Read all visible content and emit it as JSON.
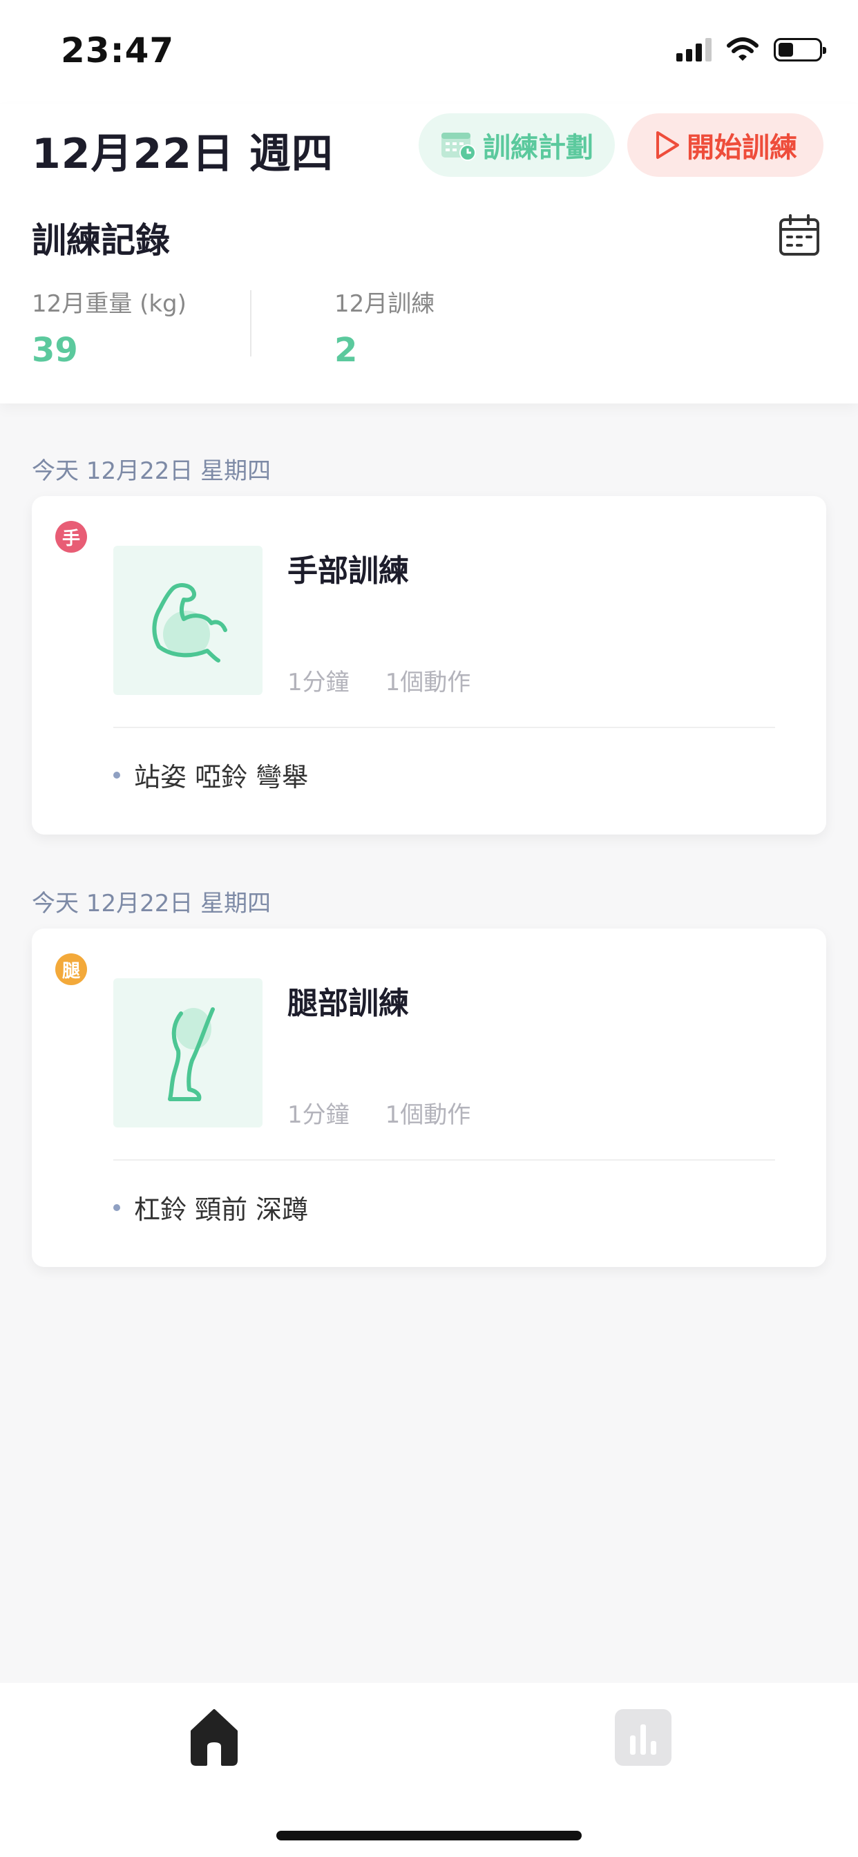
{
  "status_bar": {
    "time": "23:47",
    "icons": [
      "signal-icon",
      "wifi-icon",
      "battery-icon"
    ],
    "battery_level": 0.38
  },
  "header": {
    "date": "12月22日 週四",
    "plan_button": {
      "label": "訓練計劃",
      "icon": "calendar-clock-icon"
    },
    "start_button": {
      "label": "開始訓練",
      "icon": "play-icon"
    }
  },
  "records": {
    "title": "訓練記錄",
    "calendar_icon": "calendar-icon",
    "stats": [
      {
        "label": "12月重量 (kg)",
        "value": "39"
      },
      {
        "label": "12月訓練",
        "value": "2"
      }
    ]
  },
  "sessions": [
    {
      "day_label": "今天 12月22日 星期四",
      "badge": "手",
      "badge_color": "#e85d75",
      "icon": "bicep-icon",
      "title": "手部訓練",
      "duration": "1分鐘",
      "actions": "1個動作",
      "exercises": [
        "站姿 啞鈴 彎舉"
      ]
    },
    {
      "day_label": "今天 12月22日 星期四",
      "badge": "腿",
      "badge_color": "#f3a93a",
      "icon": "leg-icon",
      "title": "腿部訓練",
      "duration": "1分鐘",
      "actions": "1個動作",
      "exercises": [
        "杠鈴 頸前 深蹲"
      ]
    }
  ],
  "tabbar": {
    "tabs": [
      "home-icon",
      "stats-icon"
    ],
    "active": "home-icon"
  },
  "colors": {
    "accent_green": "#5bc99d",
    "accent_red": "#ee4d3b",
    "label_blue_gray": "#7d8aa6"
  }
}
